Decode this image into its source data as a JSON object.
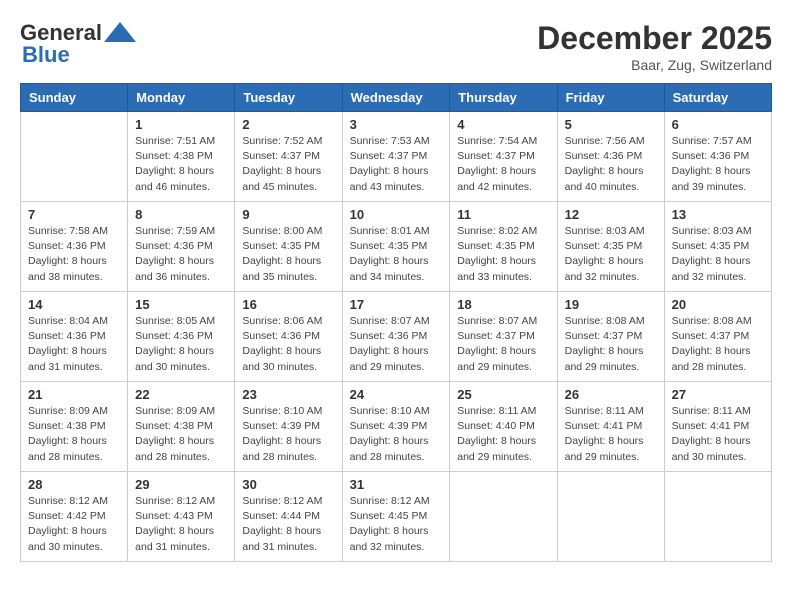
{
  "header": {
    "logo_general": "General",
    "logo_blue": "Blue",
    "month": "December 2025",
    "location": "Baar, Zug, Switzerland"
  },
  "weekdays": [
    "Sunday",
    "Monday",
    "Tuesday",
    "Wednesday",
    "Thursday",
    "Friday",
    "Saturday"
  ],
  "weeks": [
    [
      {
        "day": "",
        "info": ""
      },
      {
        "day": "1",
        "info": "Sunrise: 7:51 AM\nSunset: 4:38 PM\nDaylight: 8 hours\nand 46 minutes."
      },
      {
        "day": "2",
        "info": "Sunrise: 7:52 AM\nSunset: 4:37 PM\nDaylight: 8 hours\nand 45 minutes."
      },
      {
        "day": "3",
        "info": "Sunrise: 7:53 AM\nSunset: 4:37 PM\nDaylight: 8 hours\nand 43 minutes."
      },
      {
        "day": "4",
        "info": "Sunrise: 7:54 AM\nSunset: 4:37 PM\nDaylight: 8 hours\nand 42 minutes."
      },
      {
        "day": "5",
        "info": "Sunrise: 7:56 AM\nSunset: 4:36 PM\nDaylight: 8 hours\nand 40 minutes."
      },
      {
        "day": "6",
        "info": "Sunrise: 7:57 AM\nSunset: 4:36 PM\nDaylight: 8 hours\nand 39 minutes."
      }
    ],
    [
      {
        "day": "7",
        "info": "Sunrise: 7:58 AM\nSunset: 4:36 PM\nDaylight: 8 hours\nand 38 minutes."
      },
      {
        "day": "8",
        "info": "Sunrise: 7:59 AM\nSunset: 4:36 PM\nDaylight: 8 hours\nand 36 minutes."
      },
      {
        "day": "9",
        "info": "Sunrise: 8:00 AM\nSunset: 4:35 PM\nDaylight: 8 hours\nand 35 minutes."
      },
      {
        "day": "10",
        "info": "Sunrise: 8:01 AM\nSunset: 4:35 PM\nDaylight: 8 hours\nand 34 minutes."
      },
      {
        "day": "11",
        "info": "Sunrise: 8:02 AM\nSunset: 4:35 PM\nDaylight: 8 hours\nand 33 minutes."
      },
      {
        "day": "12",
        "info": "Sunrise: 8:03 AM\nSunset: 4:35 PM\nDaylight: 8 hours\nand 32 minutes."
      },
      {
        "day": "13",
        "info": "Sunrise: 8:03 AM\nSunset: 4:35 PM\nDaylight: 8 hours\nand 32 minutes."
      }
    ],
    [
      {
        "day": "14",
        "info": "Sunrise: 8:04 AM\nSunset: 4:36 PM\nDaylight: 8 hours\nand 31 minutes."
      },
      {
        "day": "15",
        "info": "Sunrise: 8:05 AM\nSunset: 4:36 PM\nDaylight: 8 hours\nand 30 minutes."
      },
      {
        "day": "16",
        "info": "Sunrise: 8:06 AM\nSunset: 4:36 PM\nDaylight: 8 hours\nand 30 minutes."
      },
      {
        "day": "17",
        "info": "Sunrise: 8:07 AM\nSunset: 4:36 PM\nDaylight: 8 hours\nand 29 minutes."
      },
      {
        "day": "18",
        "info": "Sunrise: 8:07 AM\nSunset: 4:37 PM\nDaylight: 8 hours\nand 29 minutes."
      },
      {
        "day": "19",
        "info": "Sunrise: 8:08 AM\nSunset: 4:37 PM\nDaylight: 8 hours\nand 29 minutes."
      },
      {
        "day": "20",
        "info": "Sunrise: 8:08 AM\nSunset: 4:37 PM\nDaylight: 8 hours\nand 28 minutes."
      }
    ],
    [
      {
        "day": "21",
        "info": "Sunrise: 8:09 AM\nSunset: 4:38 PM\nDaylight: 8 hours\nand 28 minutes."
      },
      {
        "day": "22",
        "info": "Sunrise: 8:09 AM\nSunset: 4:38 PM\nDaylight: 8 hours\nand 28 minutes."
      },
      {
        "day": "23",
        "info": "Sunrise: 8:10 AM\nSunset: 4:39 PM\nDaylight: 8 hours\nand 28 minutes."
      },
      {
        "day": "24",
        "info": "Sunrise: 8:10 AM\nSunset: 4:39 PM\nDaylight: 8 hours\nand 28 minutes."
      },
      {
        "day": "25",
        "info": "Sunrise: 8:11 AM\nSunset: 4:40 PM\nDaylight: 8 hours\nand 29 minutes."
      },
      {
        "day": "26",
        "info": "Sunrise: 8:11 AM\nSunset: 4:41 PM\nDaylight: 8 hours\nand 29 minutes."
      },
      {
        "day": "27",
        "info": "Sunrise: 8:11 AM\nSunset: 4:41 PM\nDaylight: 8 hours\nand 30 minutes."
      }
    ],
    [
      {
        "day": "28",
        "info": "Sunrise: 8:12 AM\nSunset: 4:42 PM\nDaylight: 8 hours\nand 30 minutes."
      },
      {
        "day": "29",
        "info": "Sunrise: 8:12 AM\nSunset: 4:43 PM\nDaylight: 8 hours\nand 31 minutes."
      },
      {
        "day": "30",
        "info": "Sunrise: 8:12 AM\nSunset: 4:44 PM\nDaylight: 8 hours\nand 31 minutes."
      },
      {
        "day": "31",
        "info": "Sunrise: 8:12 AM\nSunset: 4:45 PM\nDaylight: 8 hours\nand 32 minutes."
      },
      {
        "day": "",
        "info": ""
      },
      {
        "day": "",
        "info": ""
      },
      {
        "day": "",
        "info": ""
      }
    ]
  ]
}
